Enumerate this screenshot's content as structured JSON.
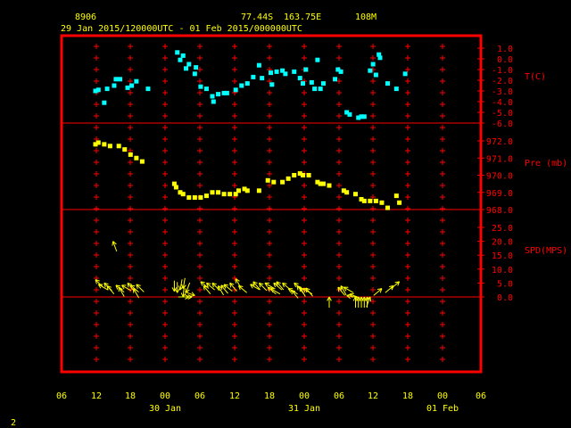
{
  "header": {
    "station": "8906",
    "lat": "77.44S",
    "lon": "163.75E",
    "elev": "108M",
    "period": "29 Jan 2015/120000UTC - 01 Feb 2015/000000UTC"
  },
  "corner_label": "2",
  "colors": {
    "frame": "#ff0000",
    "temp": "#00ffff",
    "pressure": "#ffff00",
    "wind": "#ffff00",
    "text": "#ffff00",
    "axis": "#ff0000"
  },
  "chart_data": [
    {
      "type": "scatter",
      "ylabel": "T(C)",
      "ylim": [
        -6,
        1
      ],
      "yticks": [
        "1.0",
        "0.0",
        "-1.0",
        "-2.0",
        "-3.0",
        "-4.0",
        "-5.0",
        "-6.0"
      ],
      "points": [
        [
          0,
          -3.0
        ],
        [
          0.5,
          -2.9
        ],
        [
          1.5,
          -4.1
        ],
        [
          2,
          -2.8
        ],
        [
          3.2,
          -2.5
        ],
        [
          3.5,
          -1.9
        ],
        [
          4.2,
          -1.9
        ],
        [
          5.5,
          -2.7
        ],
        [
          6.2,
          -2.5
        ],
        [
          7,
          -2.1
        ],
        [
          9,
          -2.8
        ],
        [
          14,
          0.6
        ],
        [
          14.5,
          -0.1
        ],
        [
          15,
          0.3
        ],
        [
          15.5,
          -0.9
        ],
        [
          16,
          -0.5
        ],
        [
          17,
          -1.4
        ],
        [
          17.2,
          -0.8
        ],
        [
          18,
          -2.6
        ],
        [
          19,
          -2.8
        ],
        [
          20,
          -3.5
        ],
        [
          20.2,
          -4.0
        ],
        [
          21,
          -3.3
        ],
        [
          22,
          -3.2
        ],
        [
          22.5,
          -3.2
        ],
        [
          24,
          -2.9
        ],
        [
          25,
          -2.5
        ],
        [
          26,
          -2.3
        ],
        [
          27,
          -1.7
        ],
        [
          28,
          -0.6
        ],
        [
          28.5,
          -1.8
        ],
        [
          30,
          -1.3
        ],
        [
          30.2,
          -2.4
        ],
        [
          31,
          -1.2
        ],
        [
          32,
          -1.1
        ],
        [
          32.5,
          -1.4
        ],
        [
          34,
          -1.2
        ],
        [
          35,
          -1.8
        ],
        [
          35.5,
          -2.3
        ],
        [
          36,
          -1.0
        ],
        [
          37,
          -2.2
        ],
        [
          37.5,
          -2.8
        ],
        [
          38,
          -0.1
        ],
        [
          38.5,
          -2.8
        ],
        [
          39,
          -2.3
        ],
        [
          41,
          -1.9
        ],
        [
          41.5,
          -1.0
        ],
        [
          42,
          -1.2
        ],
        [
          43,
          -5.0
        ],
        [
          43.5,
          -5.2
        ],
        [
          45,
          -5.5
        ],
        [
          45.5,
          -5.4
        ],
        [
          46,
          -5.4
        ],
        [
          47,
          -1.1
        ],
        [
          47.5,
          -0.5
        ],
        [
          48,
          -1.5
        ],
        [
          48.5,
          0.4
        ],
        [
          48.7,
          0.1
        ],
        [
          50,
          -2.3
        ],
        [
          51.5,
          -2.8
        ],
        [
          53,
          -1.4
        ]
      ]
    },
    {
      "type": "scatter",
      "ylabel": "Pre (mb)",
      "ylim": [
        968,
        972
      ],
      "yticks": [
        "972.0",
        "971.0",
        "970.0",
        "969.0",
        "968.0"
      ],
      "points": [
        [
          0,
          971.8
        ],
        [
          0.5,
          971.9
        ],
        [
          1.5,
          971.8
        ],
        [
          2.5,
          971.7
        ],
        [
          4,
          971.7
        ],
        [
          5,
          971.5
        ],
        [
          6,
          971.2
        ],
        [
          7,
          971.0
        ],
        [
          8,
          970.8
        ],
        [
          13.5,
          969.5
        ],
        [
          13.8,
          969.3
        ],
        [
          14.5,
          969.0
        ],
        [
          15,
          968.9
        ],
        [
          16,
          968.7
        ],
        [
          17,
          968.7
        ],
        [
          18,
          968.7
        ],
        [
          19,
          968.8
        ],
        [
          20,
          969.0
        ],
        [
          21,
          969.0
        ],
        [
          22,
          968.9
        ],
        [
          23,
          968.9
        ],
        [
          24,
          968.9
        ],
        [
          24.5,
          969.1
        ],
        [
          25.5,
          969.2
        ],
        [
          26,
          969.1
        ],
        [
          28,
          969.1
        ],
        [
          29.5,
          969.7
        ],
        [
          30.5,
          969.6
        ],
        [
          32,
          969.6
        ],
        [
          33,
          969.8
        ],
        [
          34,
          970.0
        ],
        [
          35,
          970.1
        ],
        [
          35.5,
          970.0
        ],
        [
          36.5,
          970.0
        ],
        [
          38,
          969.6
        ],
        [
          38.5,
          969.5
        ],
        [
          39,
          969.5
        ],
        [
          40,
          969.4
        ],
        [
          42.5,
          969.1
        ],
        [
          43,
          969.0
        ],
        [
          44.5,
          968.9
        ],
        [
          45.5,
          968.6
        ],
        [
          46,
          968.5
        ],
        [
          47,
          968.5
        ],
        [
          48,
          968.5
        ],
        [
          49,
          968.4
        ],
        [
          50,
          968.1
        ],
        [
          51.5,
          968.8
        ],
        [
          52,
          968.4
        ]
      ]
    },
    {
      "type": "scatter",
      "ylabel": "SPD(MPS)",
      "ylim": [
        0,
        25
      ],
      "yticks": [
        "25.0",
        "20.0",
        "15.0",
        "10.0",
        "5.0",
        "0.0"
      ],
      "points": [
        [
          0,
          6.2,
          135
        ],
        [
          0.5,
          4.5,
          120
        ],
        [
          1.5,
          5.0,
          135
        ],
        [
          2,
          4.0,
          140
        ],
        [
          3.5,
          4.2,
          130
        ],
        [
          4,
          3.5,
          150
        ],
        [
          4.5,
          4.2,
          120
        ],
        [
          5.5,
          5.0,
          140
        ],
        [
          6,
          4.2,
          130
        ],
        [
          6.5,
          3.0,
          150
        ],
        [
          7,
          4.5,
          135
        ],
        [
          3,
          20.0,
          160
        ],
        [
          13.5,
          2.0,
          0
        ],
        [
          14,
          1.5,
          0
        ],
        [
          14.5,
          2.5,
          10
        ],
        [
          15,
          3.0,
          10
        ],
        [
          15.5,
          1.5,
          20
        ],
        [
          15,
          0.0,
          5
        ],
        [
          16,
          0.0,
          270
        ],
        [
          16.5,
          0.0,
          270
        ],
        [
          17,
          0.5,
          290
        ],
        [
          18,
          5.5,
          130
        ],
        [
          18.5,
          4.0,
          140
        ],
        [
          19,
          5.0,
          130
        ],
        [
          20,
          5.0,
          135
        ],
        [
          21,
          4.0,
          150
        ],
        [
          21.5,
          4.2,
          140
        ],
        [
          22,
          4.5,
          130
        ],
        [
          23,
          5.0,
          140
        ],
        [
          24,
          6.5,
          150
        ],
        [
          24.5,
          4.0,
          130
        ],
        [
          26.5,
          4.5,
          120
        ],
        [
          27,
          5.5,
          140
        ],
        [
          28,
          5.0,
          135
        ],
        [
          29,
          5.0,
          120
        ],
        [
          29.5,
          3.5,
          130
        ],
        [
          30,
          3.0,
          120
        ],
        [
          30.5,
          5.0,
          130
        ],
        [
          31,
          5.5,
          140
        ],
        [
          32,
          5.0,
          130
        ],
        [
          33,
          3.0,
          120
        ],
        [
          33.5,
          2.5,
          140
        ],
        [
          34,
          5.0,
          130
        ],
        [
          34.5,
          4.0,
          140
        ],
        [
          35,
          3.5,
          150
        ],
        [
          35.5,
          3.0,
          120
        ],
        [
          36,
          3.2,
          140
        ],
        [
          40,
          0.0,
          180
        ],
        [
          41.5,
          3.5,
          140
        ],
        [
          42,
          4.0,
          150
        ],
        [
          42.5,
          3.5,
          120
        ],
        [
          43,
          0.5,
          100
        ],
        [
          43.5,
          1.0,
          110
        ],
        [
          44.5,
          0.0,
          180
        ],
        [
          45,
          0.0,
          180
        ],
        [
          45.5,
          0.0,
          180
        ],
        [
          46,
          0.0,
          180
        ],
        [
          46.5,
          0.0,
          180
        ],
        [
          47,
          0.0,
          200
        ],
        [
          49,
          3.0,
          230
        ],
        [
          51,
          4.0,
          230
        ],
        [
          52,
          5.5,
          230
        ]
      ]
    }
  ],
  "x_axis": {
    "ticks": [
      "06",
      "12",
      "18",
      "00",
      "06",
      "12",
      "18",
      "00",
      "06",
      "12",
      "18",
      "00",
      "06"
    ],
    "dates": [
      "30 Jan",
      "31 Jan",
      "01 Feb"
    ]
  }
}
